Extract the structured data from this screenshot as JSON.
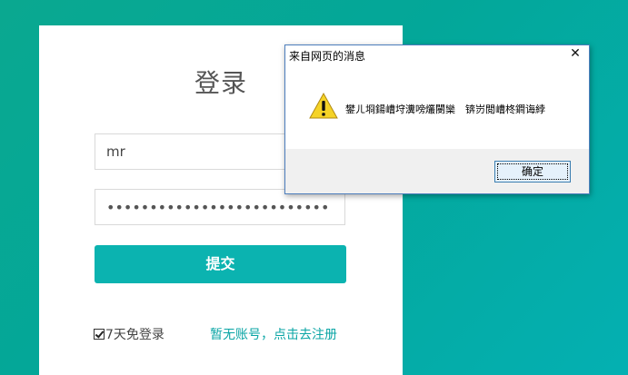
{
  "login": {
    "title": "登录",
    "username_value": "mr",
    "password_value": "••••••••••••••••••••••••••",
    "submit_label": "提交",
    "remember_label": "7天免登录",
    "register_link": "暂无账号，点击去注册"
  },
  "dialog": {
    "title": "来自网页的消息",
    "close_glyph": "✕",
    "message": "鐢ㄦ埛鍚嶆垨瀵嗙爜閿欒　锛岃閲嶆柊鐧诲綍",
    "ok_label": "确定",
    "icon": "warning-icon"
  },
  "colors": {
    "accent": "#0bb3b0",
    "link": "#0aa5a5",
    "background_start": "#0aa890",
    "background_end": "#04b0b2"
  }
}
